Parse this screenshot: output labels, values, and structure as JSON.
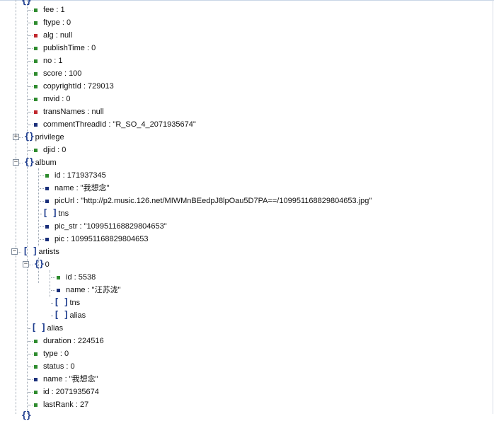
{
  "colors": {
    "number": "#2e8b2e",
    "string": "#1a2f7a",
    "null": "#c0272d",
    "bracket": "#1f3e8f"
  },
  "icons": {
    "object": "{}",
    "array": "[ ]",
    "expand": "+",
    "collapse": "−"
  },
  "rows": [
    {
      "text": "fee : 1",
      "type": "num"
    },
    {
      "text": "ftype : 0",
      "type": "num"
    },
    {
      "text": "alg : null",
      "type": "nul"
    },
    {
      "text": "publishTime : 0",
      "type": "num"
    },
    {
      "text": "no : 1",
      "type": "num"
    },
    {
      "text": "score : 100",
      "type": "num"
    },
    {
      "text": "copyrightId : 729013",
      "type": "num"
    },
    {
      "text": "mvid : 0",
      "type": "num"
    },
    {
      "text": "transNames : null",
      "type": "nul"
    },
    {
      "text": "commentThreadId : \"R_SO_4_2071935674\"",
      "type": "str"
    },
    {
      "text": "privilege",
      "type": "obj",
      "expander": "+"
    },
    {
      "text": "djid : 0",
      "type": "num"
    },
    {
      "text": "album",
      "type": "obj",
      "expander": "−"
    },
    {
      "text": "id : 171937345",
      "type": "num"
    },
    {
      "text": "name : \"我想念\"",
      "type": "str"
    },
    {
      "text": "picUrl : \"http://p2.music.126.net/MIWMnBEedpJ8lpOau5D7PA==/109951168829804653.jpg\"",
      "type": "str"
    },
    {
      "text": "tns",
      "type": "arr"
    },
    {
      "text": "pic_str : \"109951168829804653\"",
      "type": "str"
    },
    {
      "text": "pic : 109951168829804653",
      "type": "str"
    },
    {
      "text": "artists",
      "type": "arr",
      "expander": "−"
    },
    {
      "text": "0",
      "type": "obj",
      "expander": "−"
    },
    {
      "text": "id : 5538",
      "type": "num"
    },
    {
      "text": "name : \"汪苏泷\"",
      "type": "str"
    },
    {
      "text": "tns",
      "type": "arr"
    },
    {
      "text": "alias",
      "type": "arr"
    },
    {
      "text": "alias",
      "type": "arr"
    },
    {
      "text": "duration : 224516",
      "type": "num"
    },
    {
      "text": "type : 0",
      "type": "num"
    },
    {
      "text": "status : 0",
      "type": "num"
    },
    {
      "text": "name : \"我想念\"",
      "type": "str"
    },
    {
      "text": "id : 2071935674",
      "type": "num"
    },
    {
      "text": "lastRank : 27",
      "type": "num"
    }
  ]
}
